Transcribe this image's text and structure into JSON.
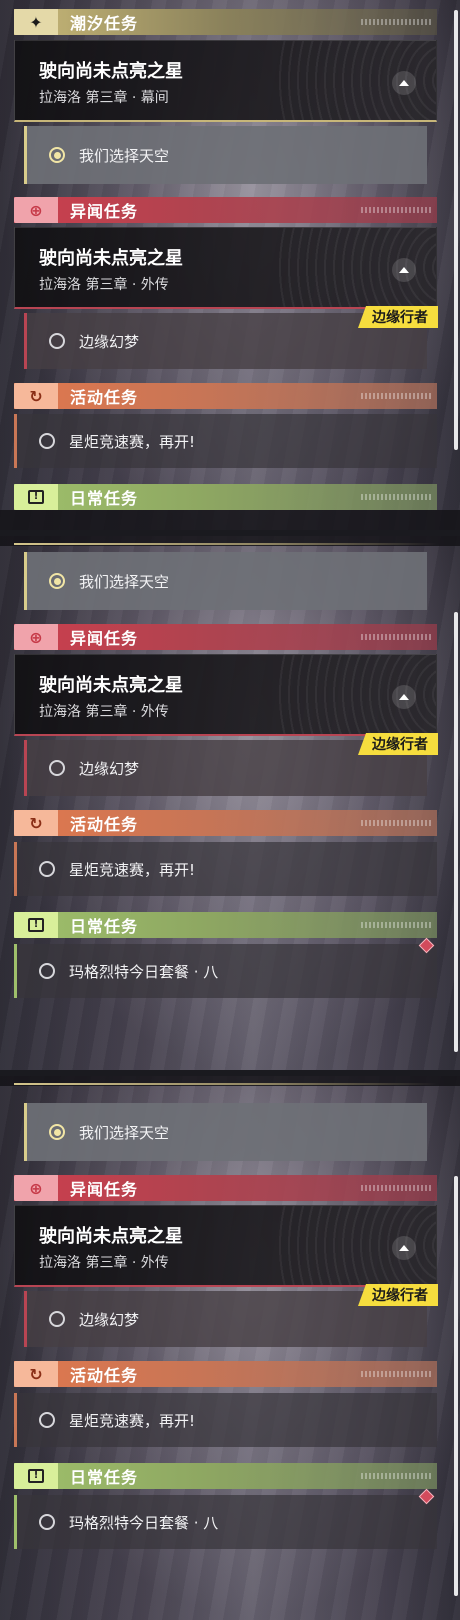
{
  "categories": {
    "trailblaze": "潮汐任务",
    "adventure": "异闻任务",
    "event": "活动任务",
    "daily": "日常任务"
  },
  "main_quest": {
    "title": "驶向尚未点亮之星",
    "subtitle": "拉海洛 第三章 · 幕间",
    "option": "我们选择天空"
  },
  "side_quest": {
    "title": "驶向尚未点亮之星",
    "subtitle": "拉海洛 第三章 · 外传",
    "tag": "边缘行者",
    "option": "边缘幻梦"
  },
  "event_quest": {
    "option": "星炬竞速赛，再开!"
  },
  "daily_quest": {
    "option": "玛格烈特今日套餐 · 八"
  },
  "icons": {
    "trailblaze": "sparkle-icon",
    "adventure": "crosshair-icon",
    "event": "refresh-icon",
    "daily": "exclamation-box-icon"
  },
  "colors": {
    "gold": "#c9b978",
    "red": "#cc3f4e",
    "orange": "#e0784e",
    "green": "#9fc06b",
    "tag": "#f6dd3e"
  }
}
